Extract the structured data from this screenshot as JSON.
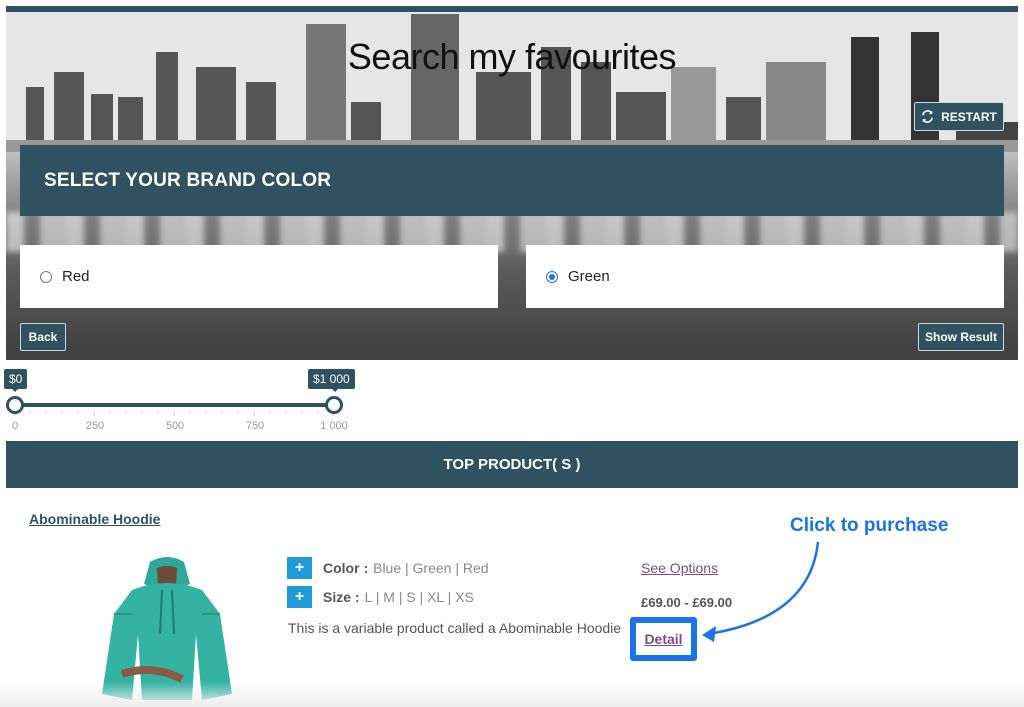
{
  "hero": {
    "title": "Search my favourites",
    "restart_label": "RESTART"
  },
  "question": {
    "title": "SELECT YOUR BRAND COLOR",
    "options": [
      {
        "label": "Red",
        "selected": false
      },
      {
        "label": "Green",
        "selected": true
      }
    ],
    "back_label": "Back",
    "show_result_label": "Show Result"
  },
  "price_filter": {
    "min_label": "$0",
    "max_label": "$1 000",
    "tick_labels": [
      "0",
      "250",
      "500",
      "750",
      "1 000"
    ],
    "selected_min": 0,
    "selected_max": 1000
  },
  "products": {
    "section_title": "TOP PRODUCT( S )",
    "items": [
      {
        "name": "Abominable Hoodie",
        "image": "teal-hoodie",
        "color_label": "Color :",
        "color_values": "Blue | Green | Red",
        "size_label": "Size :",
        "size_values": "L | M | S | XL | XS",
        "description": "This is a variable product called a Abominable Hoodie",
        "see_options_label": "See Options",
        "price": "£69.00 - £69.00",
        "detail_label": "Detail"
      }
    ]
  },
  "annotation": {
    "text": "Click to purchase",
    "color": "#1a73e8"
  },
  "colors": {
    "accent": "#2f5160",
    "link": "#7a4c8c",
    "plus_button": "#1f9bd9",
    "highlight": "#1a73e8"
  }
}
